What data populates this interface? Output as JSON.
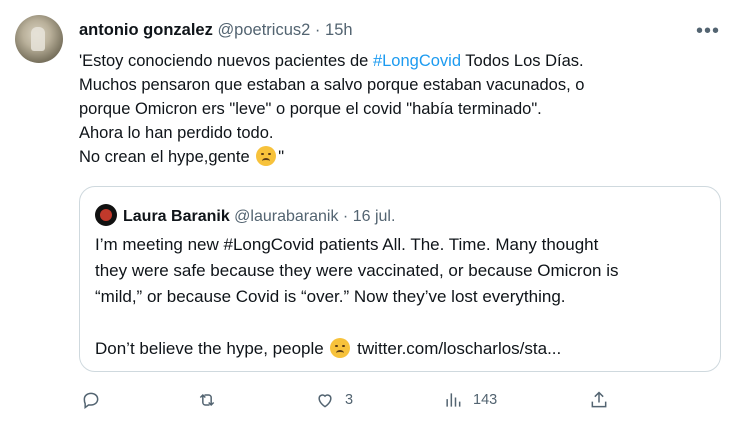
{
  "tweet": {
    "author_name": "antonio gonzalez",
    "handle": "@poetricus2",
    "separator": "·",
    "time": "15h",
    "more_label": "•••",
    "text": {
      "l1_pre": "'Estoy conociendo nuevos pacientes de ",
      "l1_tag": "#LongCovid",
      "l1_post": " Todos Los Días.",
      "l2": "Muchos pensaron que estaban a salvo porque estaban vacunados, o",
      "l3": "porque Omicron ers \"leve\" o porque el covid \"había terminado\".",
      "l4": "Ahora lo han perdido todo.",
      "l5_pre": "No crean el hype,gente ",
      "l5_post": "\""
    }
  },
  "quote": {
    "author_name": "Laura Baranik",
    "handle": "@laurabaranik",
    "separator": "·",
    "date": "16 jul.",
    "l1": "I’m meeting new #LongCovid patients All. The. Time. Many thought",
    "l2": "they were safe because they were vaccinated, or because Omicron is",
    "l3": "“mild,” or because Covid is “over.” Now they’ve lost everything.",
    "l4_pre": "Don’t believe the hype, people ",
    "l4_post": " twitter.com/loscharlos/sta..."
  },
  "actions": {
    "reply_count": "",
    "retweet_count": "",
    "like_count": "3",
    "views_count": "143"
  },
  "icons": {
    "reply": "reply-icon",
    "retweet": "retweet-icon",
    "like": "heart-icon",
    "views": "views-icon",
    "share": "share-icon",
    "emoji": "disappointed-face-emoji"
  }
}
